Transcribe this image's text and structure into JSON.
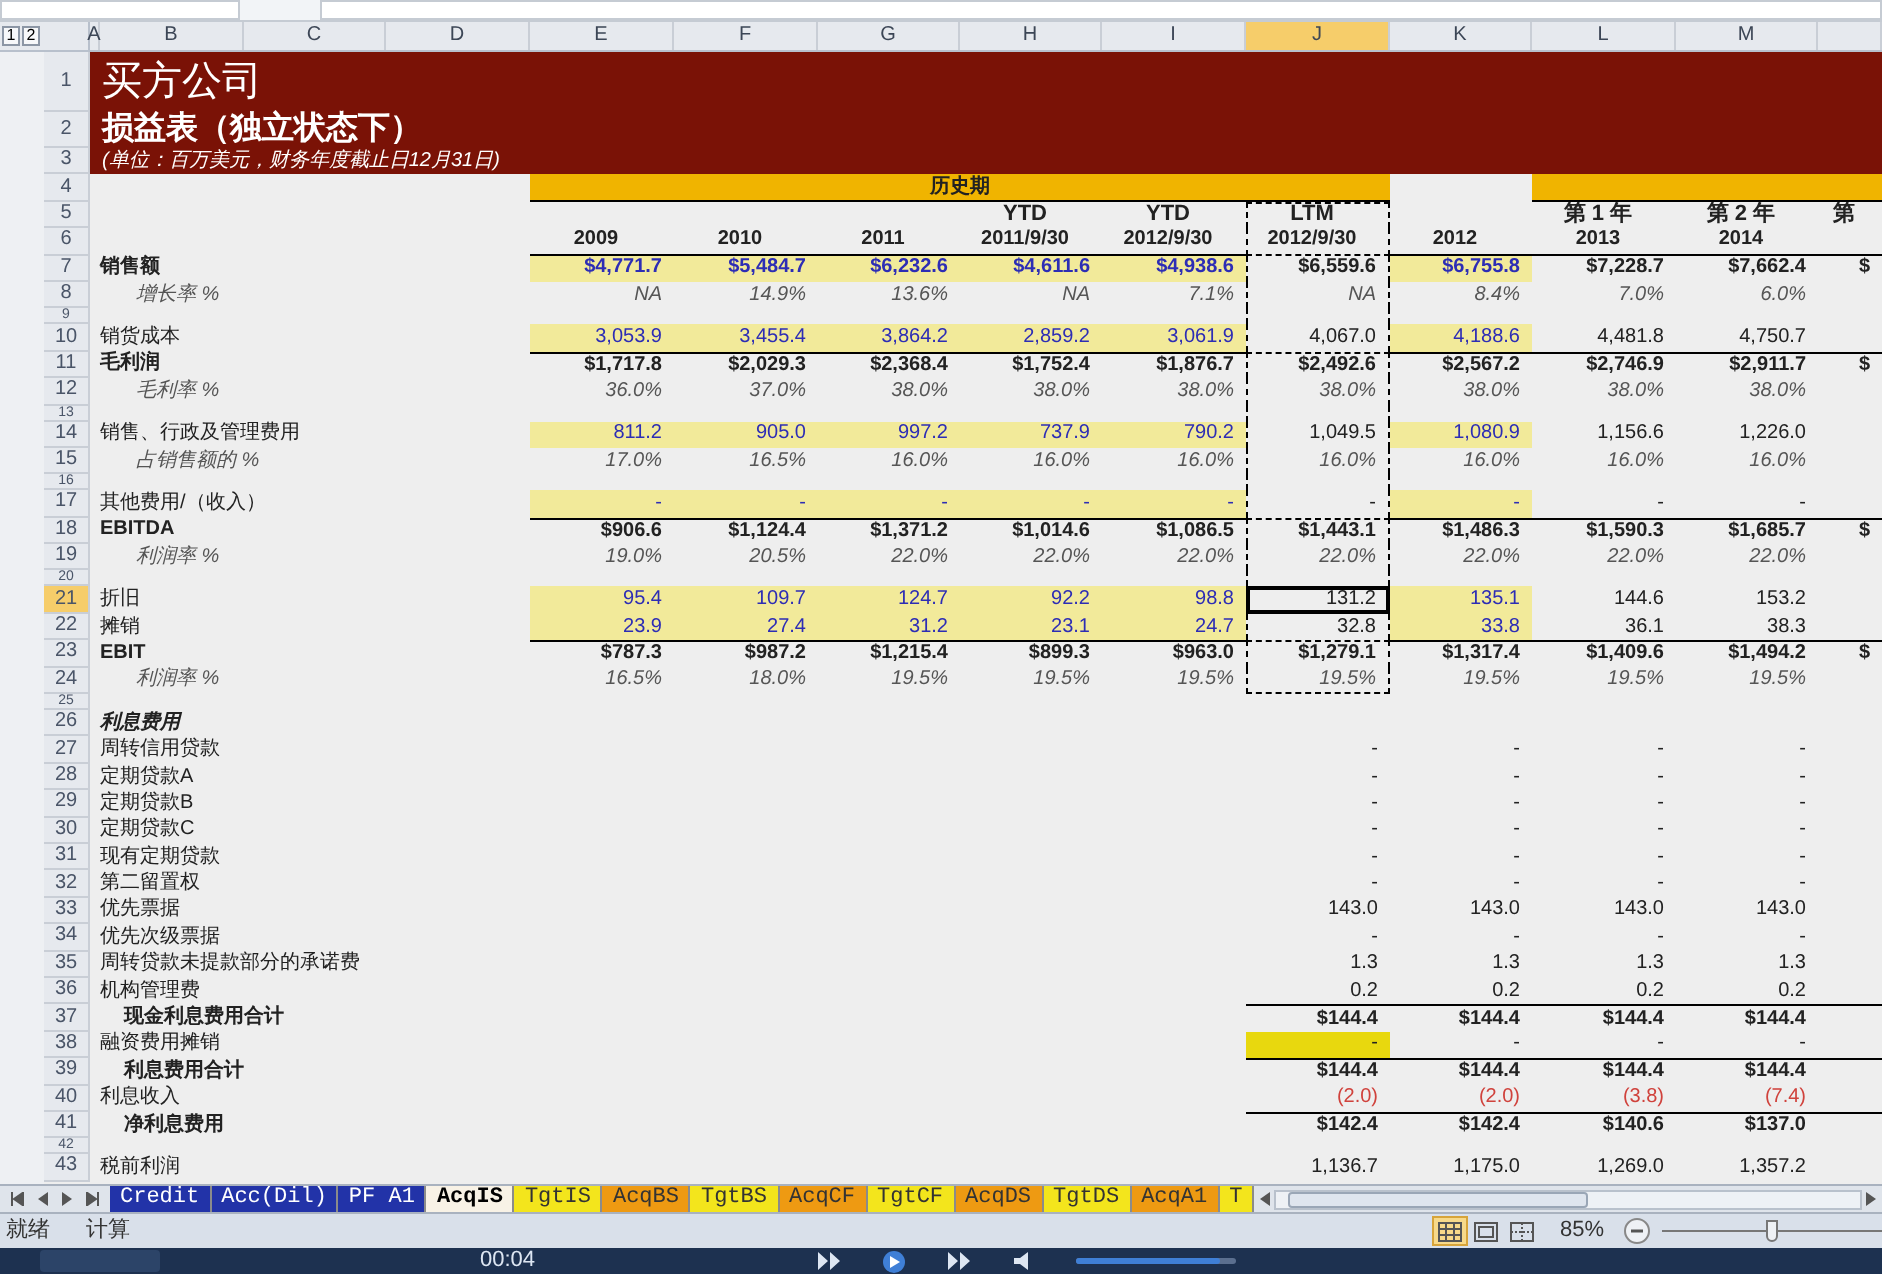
{
  "outline_levels": [
    "1",
    "2"
  ],
  "columns": [
    {
      "letter": "A",
      "selected": false
    },
    {
      "letter": "B",
      "selected": false
    },
    {
      "letter": "C",
      "selected": false
    },
    {
      "letter": "D",
      "selected": false
    },
    {
      "letter": "E",
      "selected": false,
      "input": true
    },
    {
      "letter": "F",
      "selected": false,
      "input": true
    },
    {
      "letter": "G",
      "selected": false,
      "input": true
    },
    {
      "letter": "H",
      "selected": false,
      "input": true
    },
    {
      "letter": "I",
      "selected": false,
      "input": true
    },
    {
      "letter": "J",
      "selected": true,
      "marquee": true
    },
    {
      "letter": "K",
      "selected": false,
      "input": true
    },
    {
      "letter": "L",
      "selected": false
    },
    {
      "letter": "M",
      "selected": false
    },
    {
      "selected": false
    }
  ],
  "rows": [
    {
      "num": "1",
      "kind": "title1",
      "selected": false,
      "text": "买方公司"
    },
    {
      "num": "2",
      "kind": "title2",
      "selected": false,
      "text": "损益表（独立状态下）"
    },
    {
      "num": "3",
      "kind": "title3",
      "selected": false,
      "text": "(单位：百万美元，财务年度截止日12月31日)"
    },
    {
      "num": "4",
      "kind": "band",
      "selected": false,
      "values": [
        {
          "kind": "band",
          "text": "历史期"
        },
        {
          "kind": "band"
        },
        {
          "kind": "band"
        },
        {
          "kind": "band"
        },
        {
          "kind": "band"
        },
        {
          "kind": "band"
        },
        {
          "kind": "empty"
        },
        {
          "kind": "band"
        },
        {
          "kind": "band"
        },
        {
          "kind": "band"
        }
      ]
    },
    {
      "num": "5",
      "kind": "periods",
      "selected": false,
      "in_marquee": true,
      "values": [
        {
          "kind": "empty"
        },
        {
          "kind": "empty"
        },
        {
          "kind": "empty"
        },
        "YTD",
        "YTD",
        "LTM",
        {
          "kind": "empty"
        },
        "第 1 年",
        "第 2 年",
        "第"
      ]
    },
    {
      "num": "6",
      "kind": "years",
      "selected": false,
      "in_marquee": true,
      "values": [
        "2009",
        "2010",
        "2011",
        "2011/9/30",
        "2012/9/30",
        "2012/9/30",
        "2012",
        "2013",
        "2014"
      ]
    },
    {
      "num": "7",
      "kind": "bold",
      "selected": false,
      "in_marquee": true,
      "input": true,
      "label": "销售额",
      "values": [
        "$4,771.7",
        "$5,484.7",
        "$6,232.6",
        "$4,611.6",
        "$4,938.6",
        "$6,559.6",
        "$6,755.8",
        "$7,228.7",
        "$7,662.4",
        "$"
      ]
    },
    {
      "num": "8",
      "kind": "pct",
      "selected": false,
      "in_marquee": true,
      "label": "增长率 %",
      "values": [
        "NA",
        "14.9%",
        "13.6%",
        "NA",
        "7.1%",
        "NA",
        "8.4%",
        "7.0%",
        "6.0%"
      ]
    },
    {
      "num": "9",
      "kind": "spacer",
      "selected": false,
      "in_marquee": true
    },
    {
      "num": "10",
      "kind": "normal",
      "selected": false,
      "in_marquee": true,
      "input": true,
      "label": "销货成本",
      "values": [
        "3,053.9",
        "3,455.4",
        "3,864.2",
        "2,859.2",
        "3,061.9",
        "4,067.0",
        "4,188.6",
        "4,481.8",
        "4,750.7"
      ]
    },
    {
      "num": "11",
      "kind": "total",
      "selected": false,
      "in_marquee": true,
      "label": "毛利润",
      "values": [
        "$1,717.8",
        "$2,029.3",
        "$2,368.4",
        "$1,752.4",
        "$1,876.7",
        "$2,492.6",
        "$2,567.2",
        "$2,746.9",
        "$2,911.7",
        "$"
      ]
    },
    {
      "num": "12",
      "kind": "pct",
      "selected": false,
      "in_marquee": true,
      "label": "毛利率 %",
      "values": [
        "36.0%",
        "37.0%",
        "38.0%",
        "38.0%",
        "38.0%",
        "38.0%",
        "38.0%",
        "38.0%",
        "38.0%"
      ]
    },
    {
      "num": "13",
      "kind": "spacer",
      "selected": false,
      "in_marquee": true
    },
    {
      "num": "14",
      "kind": "normal",
      "selected": false,
      "in_marquee": true,
      "input": true,
      "label": "销售、行政及管理费用",
      "values": [
        "811.2",
        "905.0",
        "997.2",
        "737.9",
        "790.2",
        "1,049.5",
        "1,080.9",
        "1,156.6",
        "1,226.0"
      ]
    },
    {
      "num": "15",
      "kind": "pct",
      "selected": false,
      "in_marquee": true,
      "label": "占销售额的 %",
      "values": [
        "17.0%",
        "16.5%",
        "16.0%",
        "16.0%",
        "16.0%",
        "16.0%",
        "16.0%",
        "16.0%",
        "16.0%"
      ]
    },
    {
      "num": "16",
      "kind": "spacer",
      "selected": false,
      "in_marquee": true
    },
    {
      "num": "17",
      "kind": "normal",
      "selected": false,
      "in_marquee": true,
      "input": true,
      "label": "其他费用/（收入）",
      "values": [
        "-",
        "-",
        "-",
        "-",
        "-",
        "-",
        "-",
        "-",
        "-"
      ]
    },
    {
      "num": "18",
      "kind": "total",
      "selected": false,
      "in_marquee": true,
      "label": "EBITDA",
      "values": [
        "$906.6",
        "$1,124.4",
        "$1,371.2",
        "$1,014.6",
        "$1,086.5",
        "$1,443.1",
        "$1,486.3",
        "$1,590.3",
        "$1,685.7",
        "$"
      ]
    },
    {
      "num": "19",
      "kind": "pct",
      "selected": false,
      "in_marquee": true,
      "label": "利润率 %",
      "values": [
        "19.0%",
        "20.5%",
        "22.0%",
        "22.0%",
        "22.0%",
        "22.0%",
        "22.0%",
        "22.0%",
        "22.0%"
      ]
    },
    {
      "num": "20",
      "kind": "spacer",
      "selected": false,
      "in_marquee": true
    },
    {
      "num": "21",
      "kind": "normal",
      "selected": true,
      "in_marquee": true,
      "input": true,
      "label": "折旧",
      "values": [
        "95.4",
        "109.7",
        "124.7",
        "92.2",
        "98.8",
        "131.2",
        "135.1",
        "144.6",
        "153.2"
      ]
    },
    {
      "num": "22",
      "kind": "normal",
      "selected": false,
      "in_marquee": true,
      "input": true,
      "label": "摊销",
      "values": [
        "23.9",
        "27.4",
        "31.2",
        "23.1",
        "24.7",
        "32.8",
        "33.8",
        "36.1",
        "38.3"
      ]
    },
    {
      "num": "23",
      "kind": "total",
      "selected": false,
      "in_marquee": true,
      "label": "EBIT",
      "values": [
        "$787.3",
        "$987.2",
        "$1,215.4",
        "$899.3",
        "$963.0",
        "$1,279.1",
        "$1,317.4",
        "$1,409.6",
        "$1,494.2",
        "$"
      ]
    },
    {
      "num": "24",
      "kind": "pct",
      "selected": false,
      "in_marquee": true,
      "label": "利润率 %",
      "values": [
        "16.5%",
        "18.0%",
        "19.5%",
        "19.5%",
        "19.5%",
        "19.5%",
        "19.5%",
        "19.5%",
        "19.5%"
      ]
    },
    {
      "num": "25",
      "kind": "spacer",
      "selected": false
    },
    {
      "num": "26",
      "kind": "section",
      "selected": false,
      "label": "利息费用"
    },
    {
      "num": "27",
      "kind": "normal",
      "selected": false,
      "label": "周转信用贷款",
      "values": [
        {
          "kind": "empty"
        },
        {
          "kind": "empty"
        },
        {
          "kind": "empty"
        },
        {
          "kind": "empty"
        },
        {
          "kind": "empty"
        },
        "-",
        "-",
        "-",
        "-"
      ]
    },
    {
      "num": "28",
      "kind": "normal",
      "selected": false,
      "label": "定期贷款A",
      "values": [
        {
          "kind": "empty"
        },
        {
          "kind": "empty"
        },
        {
          "kind": "empty"
        },
        {
          "kind": "empty"
        },
        {
          "kind": "empty"
        },
        "-",
        "-",
        "-",
        "-"
      ]
    },
    {
      "num": "29",
      "kind": "normal",
      "selected": false,
      "label": "定期贷款B",
      "values": [
        {
          "kind": "empty"
        },
        {
          "kind": "empty"
        },
        {
          "kind": "empty"
        },
        {
          "kind": "empty"
        },
        {
          "kind": "empty"
        },
        "-",
        "-",
        "-",
        "-"
      ]
    },
    {
      "num": "30",
      "kind": "normal",
      "selected": false,
      "label": "定期贷款C",
      "values": [
        {
          "kind": "empty"
        },
        {
          "kind": "empty"
        },
        {
          "kind": "empty"
        },
        {
          "kind": "empty"
        },
        {
          "kind": "empty"
        },
        "-",
        "-",
        "-",
        "-"
      ]
    },
    {
      "num": "31",
      "kind": "normal",
      "selected": false,
      "label": "现有定期贷款",
      "values": [
        {
          "kind": "empty"
        },
        {
          "kind": "empty"
        },
        {
          "kind": "empty"
        },
        {
          "kind": "empty"
        },
        {
          "kind": "empty"
        },
        "-",
        "-",
        "-",
        "-"
      ]
    },
    {
      "num": "32",
      "kind": "normal",
      "selected": false,
      "label": "第二留置权",
      "values": [
        {
          "kind": "empty"
        },
        {
          "kind": "empty"
        },
        {
          "kind": "empty"
        },
        {
          "kind": "empty"
        },
        {
          "kind": "empty"
        },
        "-",
        "-",
        "-",
        "-"
      ]
    },
    {
      "num": "33",
      "kind": "normal",
      "selected": false,
      "label": "优先票据",
      "values": [
        {
          "kind": "empty"
        },
        {
          "kind": "empty"
        },
        {
          "kind": "empty"
        },
        {
          "kind": "empty"
        },
        {
          "kind": "empty"
        },
        "143.0",
        "143.0",
        "143.0",
        "143.0"
      ]
    },
    {
      "num": "34",
      "kind": "normal",
      "selected": false,
      "label": "优先次级票据",
      "values": [
        {
          "kind": "empty"
        },
        {
          "kind": "empty"
        },
        {
          "kind": "empty"
        },
        {
          "kind": "empty"
        },
        {
          "kind": "empty"
        },
        "-",
        "-",
        "-",
        "-"
      ]
    },
    {
      "num": "35",
      "kind": "normal",
      "selected": false,
      "label": "周转贷款未提款部分的承诺费",
      "values": [
        {
          "kind": "empty"
        },
        {
          "kind": "empty"
        },
        {
          "kind": "empty"
        },
        {
          "kind": "empty"
        },
        {
          "kind": "empty"
        },
        "1.3",
        "1.3",
        "1.3",
        "1.3"
      ]
    },
    {
      "num": "36",
      "kind": "normal",
      "selected": false,
      "label": "机构管理费",
      "values": [
        {
          "kind": "empty"
        },
        {
          "kind": "empty"
        },
        {
          "kind": "empty"
        },
        {
          "kind": "empty"
        },
        {
          "kind": "empty"
        },
        "0.2",
        "0.2",
        "0.2",
        "0.2"
      ]
    },
    {
      "num": "37",
      "kind": "subtotal",
      "selected": false,
      "label": "现金利息费用合计",
      "values": [
        {
          "kind": "empty"
        },
        {
          "kind": "empty"
        },
        {
          "kind": "empty"
        },
        {
          "kind": "empty"
        },
        {
          "kind": "empty"
        },
        "$144.4",
        "$144.4",
        "$144.4",
        "$144.4",
        {
          "kind": "empty"
        }
      ]
    },
    {
      "num": "38",
      "kind": "normal",
      "selected": false,
      "label": "融资费用摊销",
      "values": [
        {
          "kind": "empty"
        },
        {
          "kind": "empty"
        },
        {
          "kind": "empty"
        },
        {
          "kind": "empty"
        },
        {
          "kind": "empty"
        },
        {
          "text": "-",
          "highlight": true
        },
        "-",
        "-",
        "-"
      ]
    },
    {
      "num": "39",
      "kind": "subtotal",
      "selected": false,
      "label": "利息费用合计",
      "values": [
        {
          "kind": "empty"
        },
        {
          "kind": "empty"
        },
        {
          "kind": "empty"
        },
        {
          "kind": "empty"
        },
        {
          "kind": "empty"
        },
        "$144.4",
        "$144.4",
        "$144.4",
        "$144.4",
        {
          "kind": "empty"
        }
      ]
    },
    {
      "num": "40",
      "kind": "negative",
      "selected": false,
      "label": "利息收入",
      "values": [
        {
          "kind": "empty"
        },
        {
          "kind": "empty"
        },
        {
          "kind": "empty"
        },
        {
          "kind": "empty"
        },
        {
          "kind": "empty"
        },
        "(2.0)",
        "(2.0)",
        "(3.8)",
        "(7.4)"
      ]
    },
    {
      "num": "41",
      "kind": "subtotal",
      "selected": false,
      "label": "净利息费用",
      "values": [
        {
          "kind": "empty"
        },
        {
          "kind": "empty"
        },
        {
          "kind": "empty"
        },
        {
          "kind": "empty"
        },
        {
          "kind": "empty"
        },
        "$142.4",
        "$142.4",
        "$140.6",
        "$137.0",
        {
          "kind": "empty"
        }
      ]
    },
    {
      "num": "42",
      "kind": "spacer",
      "selected": false
    },
    {
      "num": "43",
      "kind": "normal",
      "selected": false,
      "label": "税前利润",
      "values": [
        {
          "kind": "empty"
        },
        {
          "kind": "empty"
        },
        {
          "kind": "empty"
        },
        {
          "kind": "empty"
        },
        {
          "kind": "empty"
        },
        "1,136.7",
        "1,175.0",
        "1,269.0",
        "1,357.2"
      ]
    }
  ],
  "sheet_tabs": [
    {
      "label": "Credit",
      "color": "#2233a8",
      "selected": false
    },
    {
      "label": "Acc(Dil)",
      "color": "#2233a8",
      "selected": false
    },
    {
      "label": "PF A1",
      "color": "#2233a8",
      "selected": false
    },
    {
      "label": "AcqIS",
      "color": "#f8f2e6",
      "selected": true
    },
    {
      "label": "TgtIS",
      "color": "#f3e51c",
      "selected": false
    },
    {
      "label": "AcqBS",
      "color": "#ee9a12",
      "selected": false
    },
    {
      "label": "TgtBS",
      "color": "#f3e51c",
      "selected": false
    },
    {
      "label": "AcqCF",
      "color": "#ee9a12",
      "selected": false
    },
    {
      "label": "TgtCF",
      "color": "#f3e51c",
      "selected": false
    },
    {
      "label": "AcqDS",
      "color": "#ee9a12",
      "selected": false
    },
    {
      "label": "TgtDS",
      "color": "#f3e51c",
      "selected": false
    },
    {
      "label": "AcqA1",
      "color": "#ee9a12",
      "selected": false
    },
    {
      "label": "T",
      "color": "#f3e51c",
      "selected": false
    }
  ],
  "status_bar": {
    "mode": "就绪",
    "calc": "计算",
    "zoom": "85%",
    "zoom_slider": {
      "level": 0.5
    },
    "views": [
      {
        "kind": "normal",
        "selected": true
      },
      {
        "kind": "layout",
        "selected": false
      },
      {
        "kind": "pagebreak",
        "selected": false
      }
    ]
  },
  "player": {
    "time": "00:04",
    "volume": {
      "level": 0.9
    }
  }
}
